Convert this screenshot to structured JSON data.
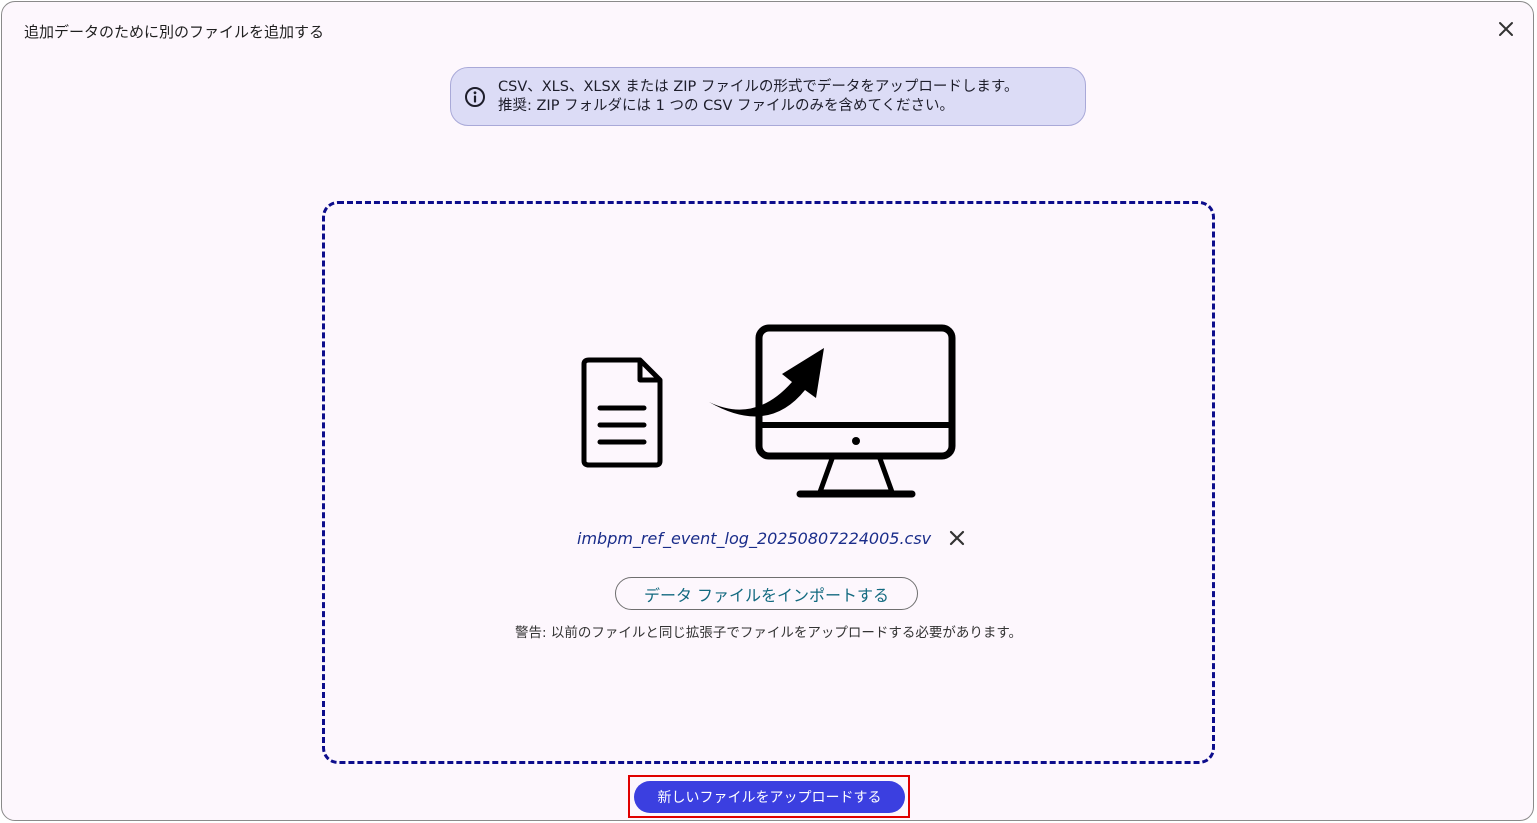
{
  "dialog": {
    "title": "追加データのために別のファイルを追加する",
    "close_icon": "close-icon"
  },
  "info_banner": {
    "icon": "info-icon",
    "line1": "CSV、XLS、XLSX または ZIP ファイルの形式でデータをアップロードします。",
    "line2": "推奨: ZIP フォルダには 1 つの CSV ファイルのみを含めてください。"
  },
  "drop_zone": {
    "illustration_icons": [
      "document-icon",
      "upload-arrow-icon",
      "monitor-icon"
    ],
    "selected_file": "imbpm_ref_event_log_20250807224005.csv",
    "remove_icon": "remove-file-icon",
    "import_button_label": "データ ファイルをインポートする",
    "warning": "警告: 以前のファイルと同じ拡張子でファイルをアップロードする必要があります。"
  },
  "footer": {
    "upload_button_label": "新しいファイルをアップロードする"
  },
  "colors": {
    "dialog_background": "#fdf7fd",
    "banner_background": "#dcdcf6",
    "dashed_border": "#0d0d8c",
    "file_name": "#1a2d8a",
    "import_text": "#136a80",
    "primary_button": "#3b3fe0",
    "highlight_border": "#e00000"
  }
}
